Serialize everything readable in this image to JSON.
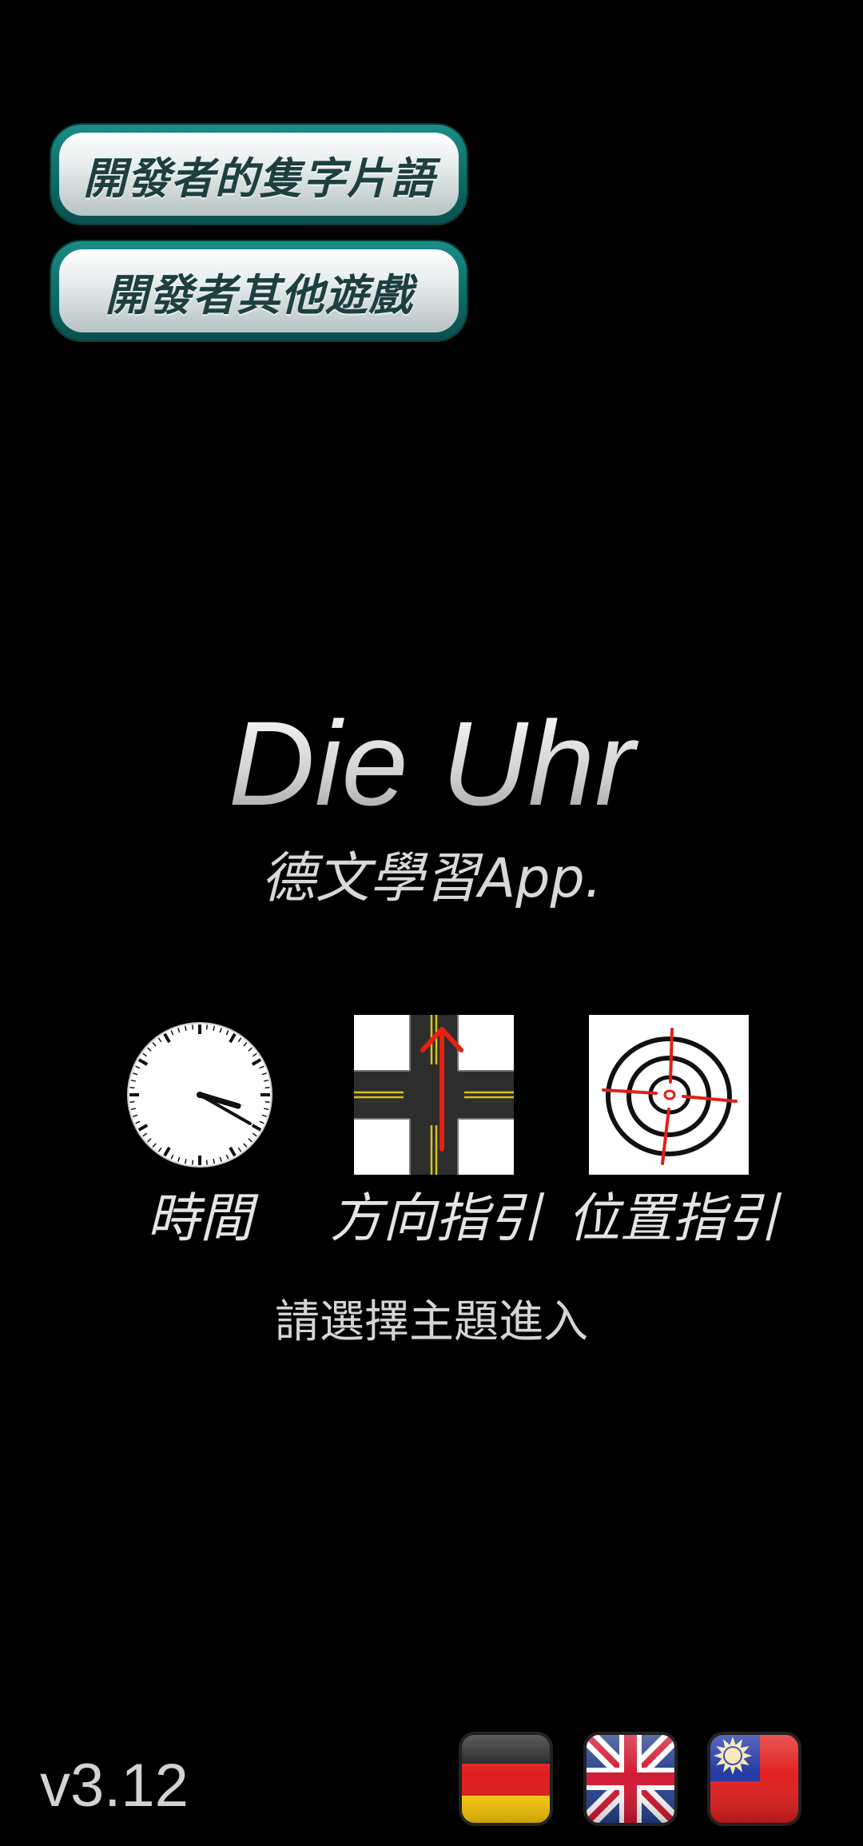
{
  "top_buttons": {
    "phrases_label": "開發者的隻字片語",
    "games_label": "開發者其他遊戲"
  },
  "title": "Die Uhr",
  "subtitle": "德文學習App.",
  "topics": [
    {
      "label": "時間",
      "icon": "clock-icon"
    },
    {
      "label": "方向指引",
      "icon": "intersection-arrow-icon"
    },
    {
      "label": "位置指引",
      "icon": "target-crosshair-icon"
    }
  ],
  "hint": "請選擇主題進入",
  "version": "v3.12",
  "languages": [
    {
      "icon": "germany-flag-icon"
    },
    {
      "icon": "uk-flag-icon"
    },
    {
      "icon": "taiwan-flag-icon"
    }
  ],
  "colors": {
    "background": "#000000",
    "button_frame": "#0f6e69",
    "button_text": "#1d3f3f",
    "arrow_red": "#e8200f"
  }
}
